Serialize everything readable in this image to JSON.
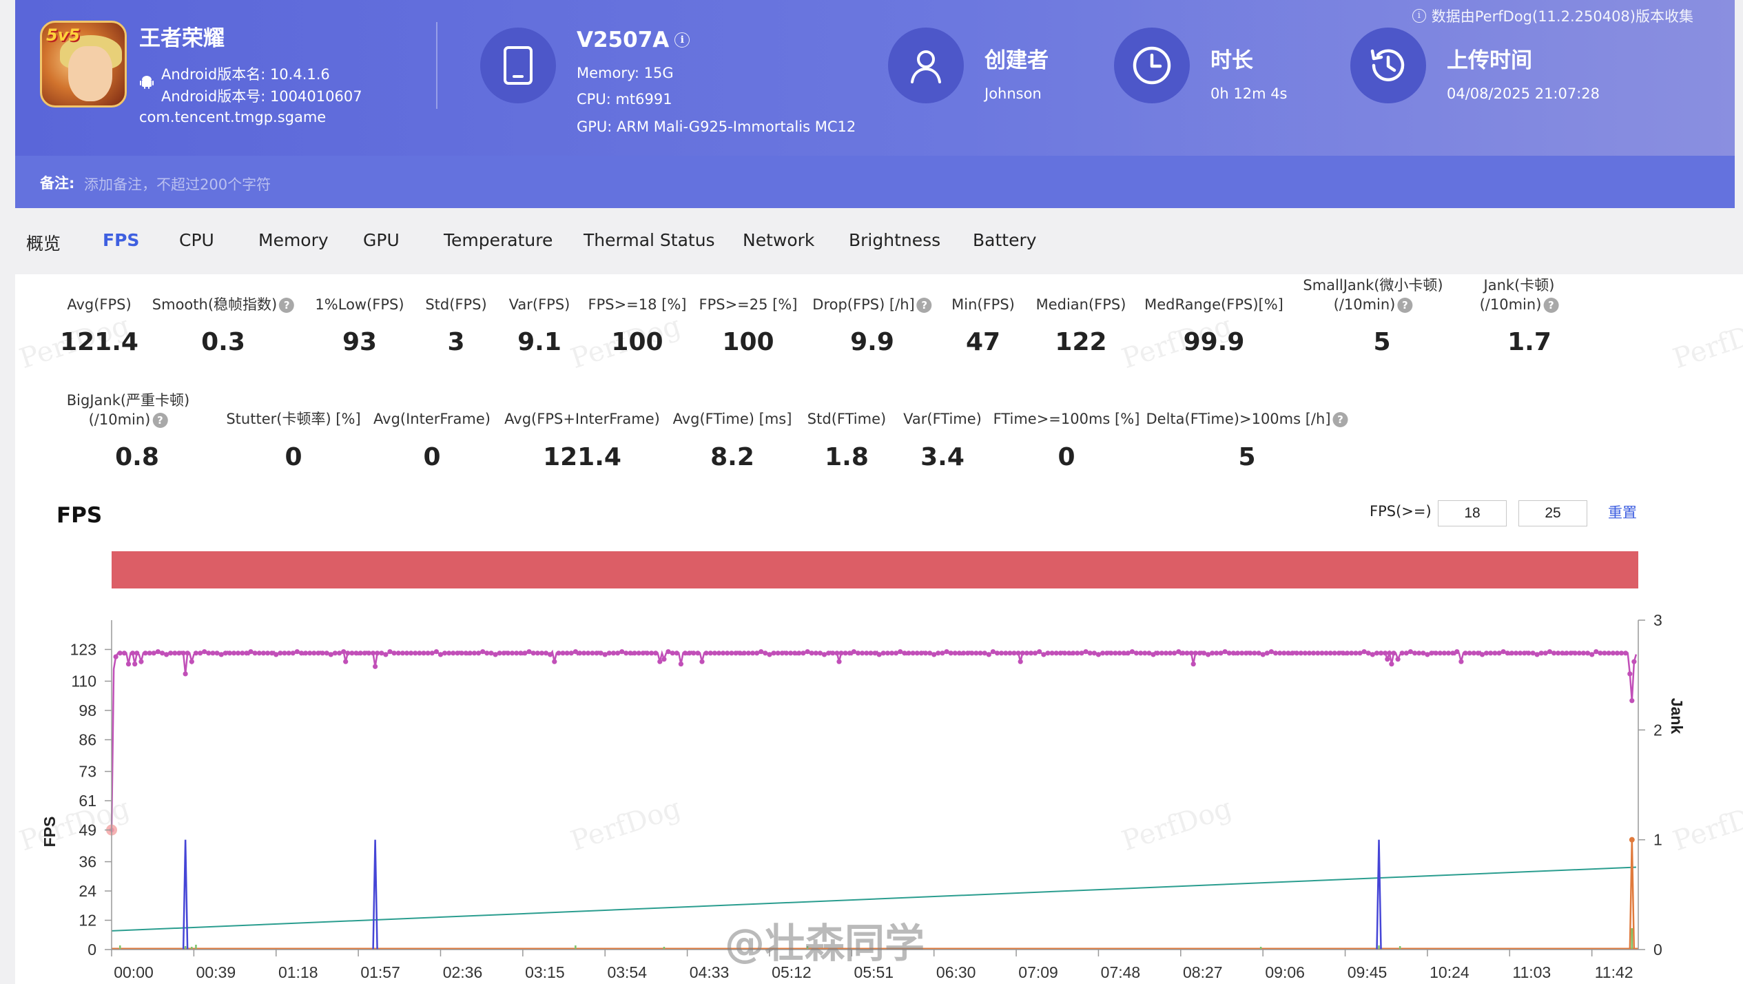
{
  "header": {
    "app_name": "王者荣耀",
    "android_version_name": "Android版本名: 10.4.1.6",
    "android_version_code": "Android版本号: 1004010607",
    "package": "com.tencent.tmgp.sgame",
    "app_icon_badge": "5v5",
    "device_model": "V2507A",
    "memory": "Memory: 15G",
    "cpu": "CPU: mt6991",
    "gpu": "GPU: ARM Mali-G925-Immortalis MC12",
    "creator_title": "创建者",
    "creator_value": "Johnson",
    "duration_title": "时长",
    "duration_value": "0h 12m 4s",
    "upload_title": "上传时间",
    "upload_value": "04/08/2025 21:07:28",
    "collect_note": "数据由PerfDog(11.2.250408)版本收集",
    "note_label": "备注:",
    "note_placeholder": "添加备注，不超过200个字符"
  },
  "tabs": [
    {
      "label": "概览",
      "active": false
    },
    {
      "label": "FPS",
      "active": true
    },
    {
      "label": "CPU",
      "active": false
    },
    {
      "label": "Memory",
      "active": false
    },
    {
      "label": "GPU",
      "active": false
    },
    {
      "label": "Temperature",
      "active": false
    },
    {
      "label": "Thermal Status",
      "active": false
    },
    {
      "label": "Network",
      "active": false
    },
    {
      "label": "Brightness",
      "active": false
    },
    {
      "label": "Battery",
      "active": false
    }
  ],
  "metrics_row1": [
    {
      "label": "Avg(FPS)",
      "value": "121.4",
      "help": false
    },
    {
      "label": "Smooth(稳帧指数)",
      "value": "0.3",
      "help": true
    },
    {
      "label": "1%Low(FPS)",
      "value": "93",
      "help": false
    },
    {
      "label": "Std(FPS)",
      "value": "3",
      "help": false
    },
    {
      "label": "Var(FPS)",
      "value": "9.1",
      "help": false
    },
    {
      "label": "FPS>=18 [%]",
      "value": "100",
      "help": false
    },
    {
      "label": "FPS>=25 [%]",
      "value": "100",
      "help": false
    },
    {
      "label": "Drop(FPS) [/h]",
      "value": "9.9",
      "help": true
    },
    {
      "label": "Min(FPS)",
      "value": "47",
      "help": false
    },
    {
      "label": "Median(FPS)",
      "value": "122",
      "help": false
    },
    {
      "label": "MedRange(FPS)[%]",
      "value": "99.9",
      "help": false
    },
    {
      "label": "SmallJank(微小卡顿)",
      "label2": "(/10min)",
      "value": "5",
      "help": true
    },
    {
      "label": "Jank(卡顿)",
      "label2": "(/10min)",
      "value": "1.7",
      "help": true
    }
  ],
  "metrics_row2": [
    {
      "label": "BigJank(严重卡顿)",
      "label2": "(/10min)",
      "value": "0.8",
      "help": true
    },
    {
      "label": "Stutter(卡顿率) [%]",
      "value": "0",
      "help": false
    },
    {
      "label": "Avg(InterFrame)",
      "value": "0",
      "help": false
    },
    {
      "label": "Avg(FPS+InterFrame)",
      "value": "121.4",
      "help": false
    },
    {
      "label": "Avg(FTime) [ms]",
      "value": "8.2",
      "help": false
    },
    {
      "label": "Std(FTime)",
      "value": "1.8",
      "help": false
    },
    {
      "label": "Var(FTime)",
      "value": "3.4",
      "help": false
    },
    {
      "label": "FTime>=100ms [%]",
      "value": "0",
      "help": false
    },
    {
      "label": "Delta(FTime)>100ms [/h]",
      "value": "5",
      "help": true
    }
  ],
  "chart_controls": {
    "title": "FPS",
    "fps_ge_label": "FPS(>=)",
    "threshold1": "18",
    "threshold2": "25",
    "reset_label": "重置"
  },
  "watermarks": [
    "PerfDog",
    "PerfDog",
    "PerfDog",
    "PerfDog",
    "PerfDog",
    "PerfDog",
    "PerfDog",
    "PerfDog"
  ],
  "weibo_watermark": "@壮森同学",
  "colors": {
    "header_bg": "#5a66d9",
    "accent_blue": "#3e5fe0",
    "fps_line": "#c14fb8",
    "status_bar": "#dc5e66",
    "jank_line": "#4545d6",
    "smalljank_line": "#e07a3c",
    "trend_line": "#2a9d8f",
    "other_line": "#7cc46a"
  },
  "chart_data": {
    "type": "line",
    "ylabel": "FPS",
    "y2label": "Jank",
    "yticks": [
      0,
      12,
      24,
      36,
      49,
      61,
      73,
      86,
      98,
      110,
      123
    ],
    "ylim": [
      0,
      135
    ],
    "y2ticks": [
      0,
      1,
      2,
      3
    ],
    "y2lim": [
      0,
      3
    ],
    "xlim": [
      0,
      724
    ],
    "xtick_labels": [
      "00:00",
      "00:39",
      "01:18",
      "01:57",
      "02:36",
      "03:15",
      "03:54",
      "04:33",
      "05:12",
      "05:51",
      "06:30",
      "07:09",
      "07:48",
      "08:27",
      "09:06",
      "09:45",
      "10:24",
      "11:03",
      "11:42"
    ],
    "status_bar_range": [
      "00:00",
      "12:04"
    ],
    "series": [
      {
        "name": "FPS",
        "baseline": 121.5,
        "start": [
          [
            0,
            49
          ],
          [
            1,
            115
          ],
          [
            2,
            120
          ]
        ],
        "dips": [
          [
            8,
            117
          ],
          [
            11,
            117
          ],
          [
            14,
            118
          ],
          [
            35,
            113
          ],
          [
            38,
            118
          ],
          [
            111,
            118
          ],
          [
            125,
            116
          ],
          [
            210,
            118
          ],
          [
            260,
            118
          ],
          [
            262,
            119
          ],
          [
            270,
            117
          ],
          [
            280,
            118
          ],
          [
            345,
            118
          ],
          [
            431,
            118
          ],
          [
            513,
            117
          ],
          [
            605,
            119
          ],
          [
            607,
            117
          ],
          [
            610,
            119
          ],
          [
            640,
            118
          ],
          [
            720,
            113
          ],
          [
            721,
            102
          ],
          [
            722,
            118
          ]
        ],
        "end": [
          [
            723,
            121
          ]
        ]
      },
      {
        "name": "Jank",
        "axis": "right",
        "spikes": [
          [
            35,
            1
          ],
          [
            125,
            1
          ],
          [
            601,
            1
          ]
        ]
      },
      {
        "name": "BigJank",
        "axis": "right",
        "spikes": [
          [
            721,
            1
          ]
        ]
      },
      {
        "name": "Trend",
        "axis": "right",
        "points": [
          [
            0,
            0.17
          ],
          [
            723,
            0.75
          ]
        ]
      }
    ]
  }
}
